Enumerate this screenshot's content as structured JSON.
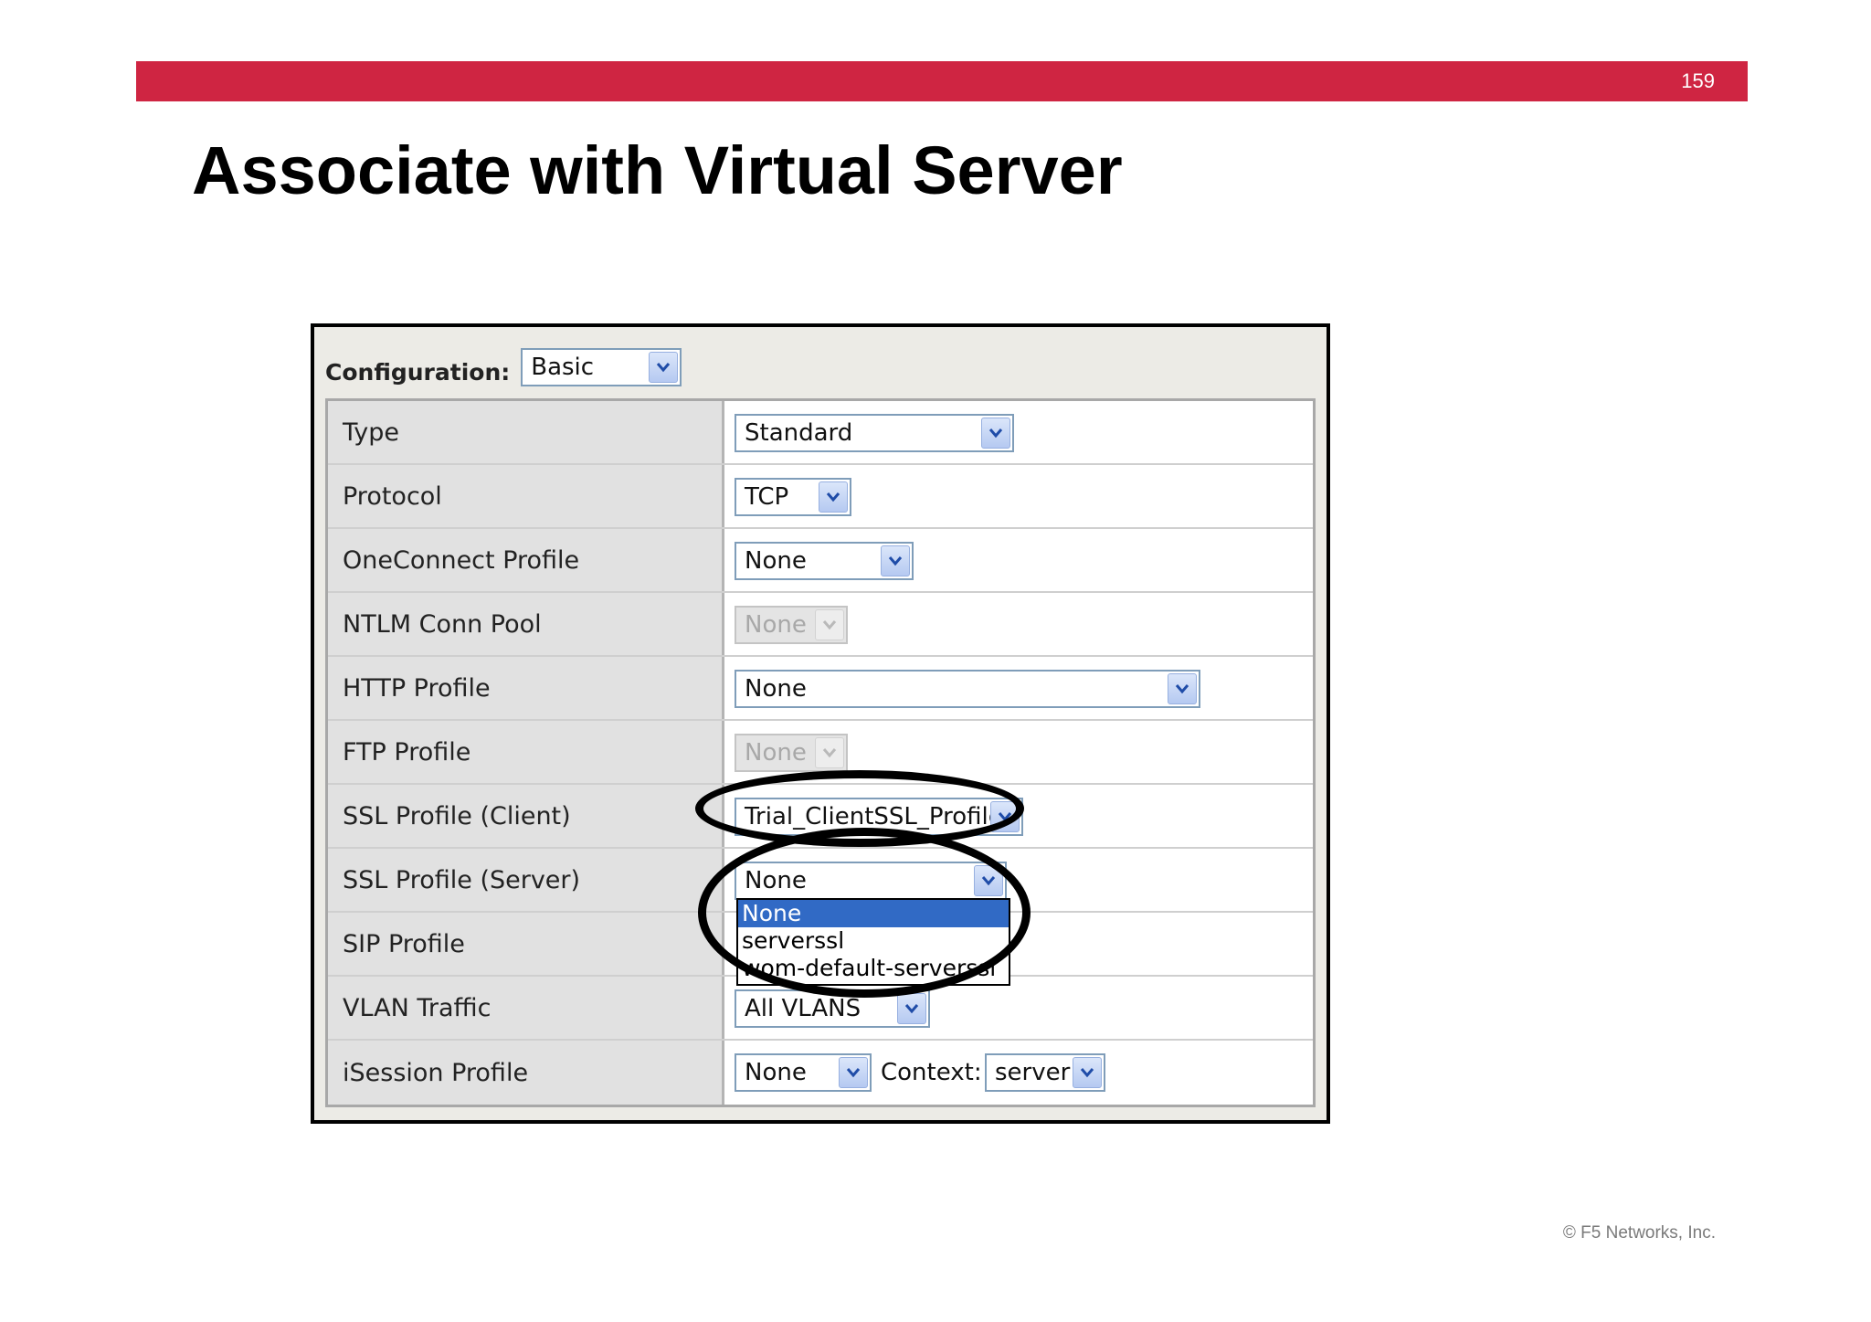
{
  "slide": {
    "number": "159",
    "title": "Associate with Virtual Server",
    "copyright": "© F5 Networks, Inc."
  },
  "colors": {
    "accent_bar": "#cf2542",
    "selection_highlight": "#316ac5"
  },
  "form": {
    "configuration": {
      "label": "Configuration:",
      "value": "Basic"
    },
    "rows": [
      {
        "label": "Type",
        "value": "Standard"
      },
      {
        "label": "Protocol",
        "value": "TCP"
      },
      {
        "label": "OneConnect Profile",
        "value": "None"
      },
      {
        "label": "NTLM Conn Pool",
        "value": "None"
      },
      {
        "label": "HTTP Profile",
        "value": "None"
      },
      {
        "label": "FTP Profile",
        "value": "None"
      },
      {
        "label": "SSL Profile (Client)",
        "value": "Trial_ClientSSL_Profile"
      },
      {
        "label": "SSL Profile (Server)",
        "value": "None"
      },
      {
        "label": "SIP Profile",
        "value": ""
      },
      {
        "label": "VLAN Traffic",
        "value": "All VLANS"
      },
      {
        "label": "iSession Profile",
        "value": "None",
        "context_label": "Context:",
        "context_value": "server"
      }
    ],
    "server_ssl_dropdown": {
      "options": [
        "None",
        "serverssl",
        "wom-default-serverssl"
      ]
    }
  }
}
